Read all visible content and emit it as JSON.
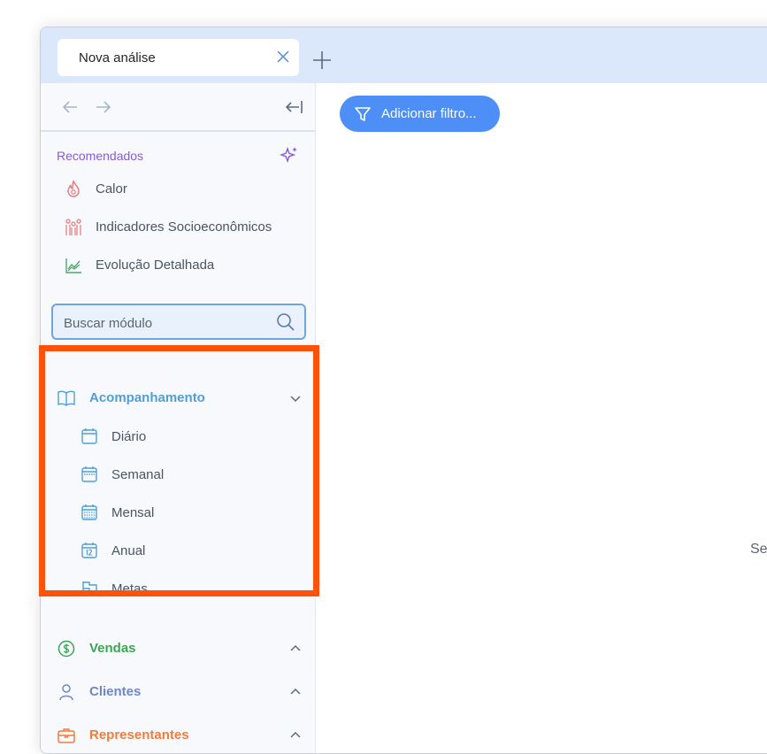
{
  "tabs": [
    {
      "title": "Nova análise"
    }
  ],
  "sidebar": {
    "recommended": {
      "title": "Recomendados",
      "items": [
        {
          "label": "Calor",
          "icon": "fire-icon"
        },
        {
          "label": "Indicadores Socioeconômicos",
          "icon": "people-icon"
        },
        {
          "label": "Evolução Detalhada",
          "icon": "line-chart-icon"
        }
      ]
    },
    "search": {
      "placeholder": "Buscar módulo"
    },
    "groups": [
      {
        "label": "Acompanhamento",
        "icon": "book-icon",
        "color": "#4f9fd6",
        "expanded": true,
        "items": [
          {
            "label": "Diário",
            "icon": "calendar-day-icon"
          },
          {
            "label": "Semanal",
            "icon": "calendar-week-icon"
          },
          {
            "label": "Mensal",
            "icon": "calendar-month-icon"
          },
          {
            "label": "Anual",
            "icon": "calendar-year-icon"
          },
          {
            "label": "Metas",
            "icon": "flag-icon"
          }
        ]
      },
      {
        "label": "Vendas",
        "icon": "dollar-circle-icon",
        "color": "#3aa655",
        "expanded": false
      },
      {
        "label": "Clientes",
        "icon": "user-icon",
        "color": "#6f86cc",
        "expanded": false
      },
      {
        "label": "Representantes",
        "icon": "briefcase-icon",
        "color": "#f07d3f",
        "expanded": false
      }
    ]
  },
  "toolbar": {
    "filter_label": "Adicionar filtro..."
  },
  "main": {
    "partial_text": "Se"
  },
  "colors": {
    "accent": "#4d8ff6",
    "highlight": "#fe520b",
    "recommended": "#8a5ad8"
  }
}
